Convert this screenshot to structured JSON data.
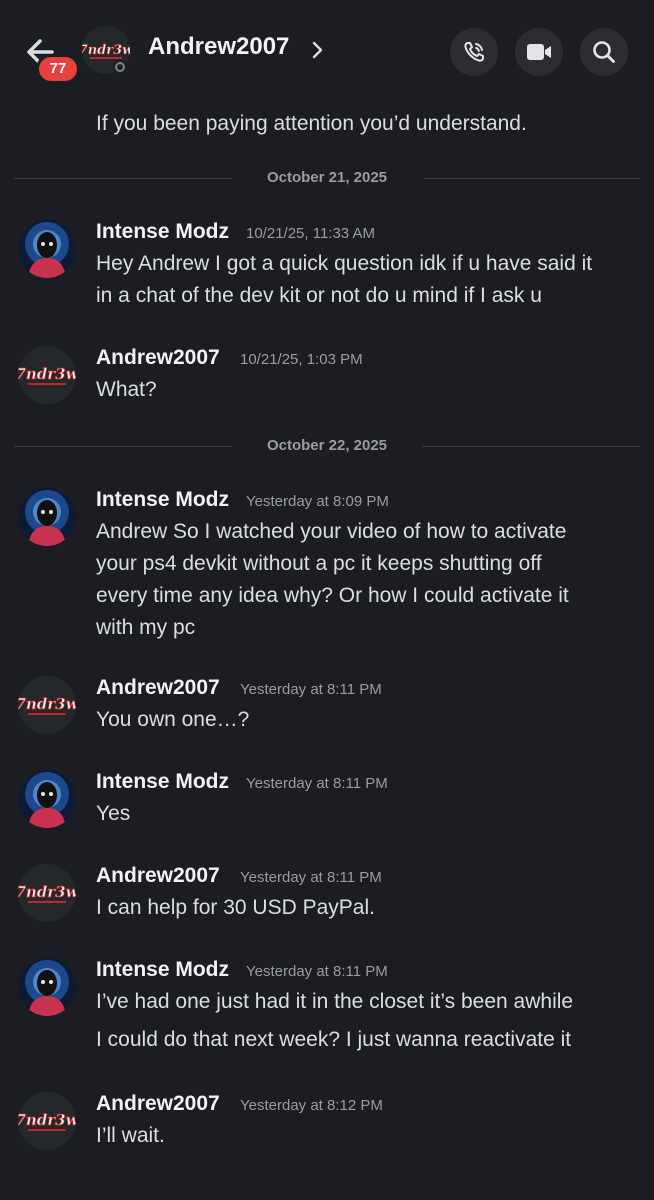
{
  "header": {
    "title": "Andrew2007",
    "unread_count": "77",
    "avatar_text": "7ndr3w"
  },
  "prior_message": {
    "text": "If you been paying attention you’d understand."
  },
  "dividers": [
    {
      "label": "October 21, 2025"
    },
    {
      "label": "October 22, 2025"
    }
  ],
  "messages": [
    {
      "author": "Intense Modz",
      "timestamp": "10/21/25, 11:33 AM",
      "lines": [
        "Hey Andrew I got a quick question idk if u have said it",
        "in a chat of the dev kit or not do u mind if I ask u"
      ]
    },
    {
      "author": "Andrew2007",
      "timestamp": "10/21/25, 1:03 PM",
      "lines": [
        "What?"
      ]
    },
    {
      "author": "Intense Modz",
      "timestamp": "Yesterday at 8:09 PM",
      "lines": [
        "Andrew So I watched your video of how to activate",
        "your ps4 devkit without a pc it keeps shutting off",
        "every time any idea why? Or how I could activate it",
        "with my pc"
      ]
    },
    {
      "author": "Andrew2007",
      "timestamp": "Yesterday at 8:11 PM",
      "lines": [
        "You own one…?"
      ]
    },
    {
      "author": "Intense Modz",
      "timestamp": "Yesterday at 8:11 PM",
      "lines": [
        "Yes"
      ]
    },
    {
      "author": "Andrew2007",
      "timestamp": "Yesterday at 8:11 PM",
      "lines": [
        "I can help for 30 USD PayPal."
      ]
    },
    {
      "author": "Intense Modz",
      "timestamp": "Yesterday at 8:11 PM",
      "lines": [
        "I’ve had one just had it in the closet it’s been awhile",
        "I could do that next week? I just wanna reactivate it"
      ]
    },
    {
      "author": "Andrew2007",
      "timestamp": "Yesterday at 8:12 PM",
      "lines": [
        "I’ll wait."
      ]
    }
  ],
  "colors": {
    "background": "#1c1d22",
    "badge": "#e5413d",
    "text": "#dbdee1",
    "muted": "#9a9ca3"
  },
  "icons": {
    "back": "arrow-left-icon",
    "chevron": "chevron-right-icon",
    "call": "phone-call-icon",
    "video": "video-camera-icon",
    "search": "search-icon"
  }
}
